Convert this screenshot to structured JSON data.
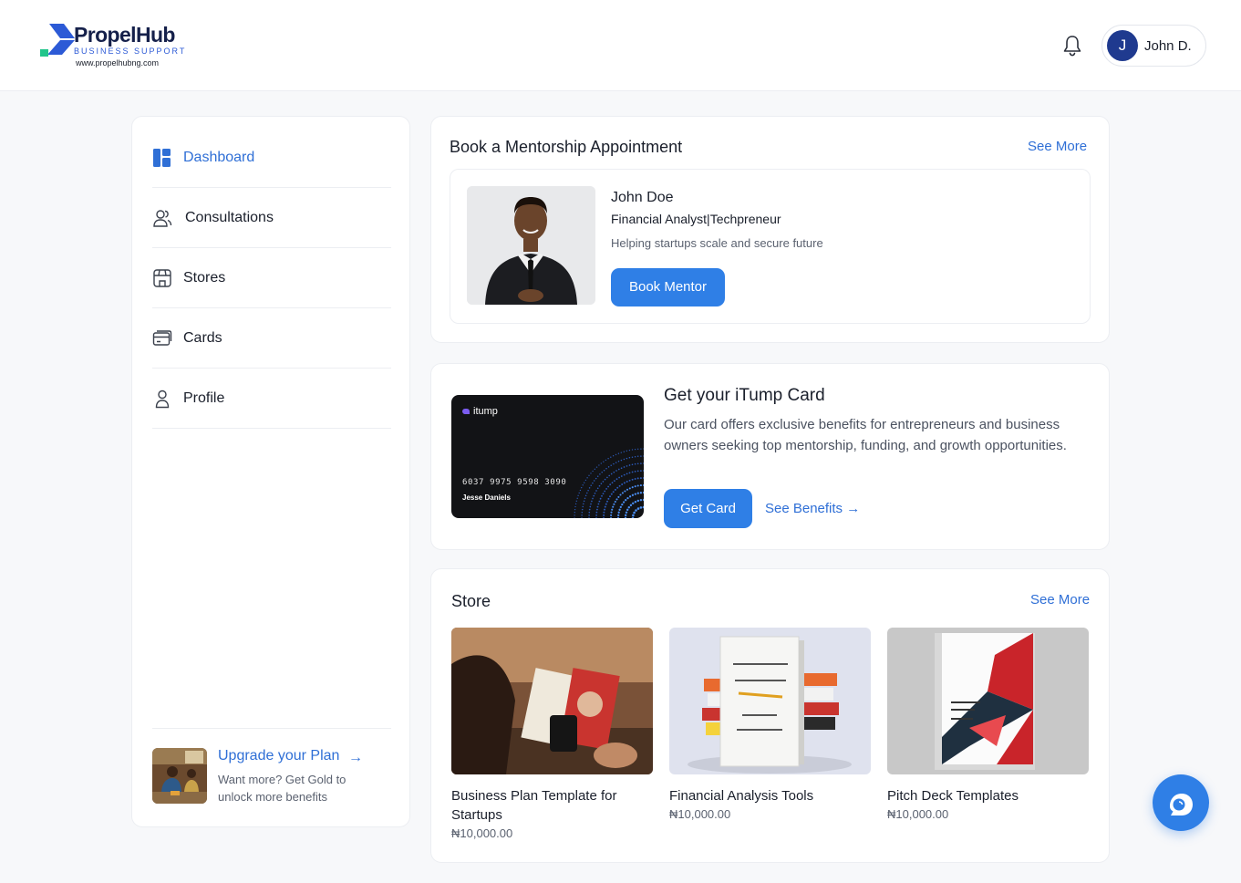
{
  "brand": {
    "name": "PropelHub",
    "subtitle": "BUSINESS SUPPORT",
    "url": "www.propelhubng.com"
  },
  "header": {
    "user_initial": "J",
    "user_name": "John D.",
    "icons": [
      "bell-icon"
    ]
  },
  "sidebar": {
    "items": [
      {
        "label": "Dashboard",
        "icon": "dashboard-icon",
        "active": true
      },
      {
        "label": "Consultations",
        "icon": "users-icon"
      },
      {
        "label": "Stores",
        "icon": "store-icon"
      },
      {
        "label": "Cards",
        "icon": "card-icon"
      },
      {
        "label": "Profile",
        "icon": "user-icon"
      }
    ],
    "upgrade": {
      "title": "Upgrade your Plan",
      "arrow": "→",
      "description": "Want more? Get Gold to unlock more benefits"
    }
  },
  "mentorship": {
    "title": "Book a Mentorship Appointment",
    "see_more": "See More",
    "mentor_name": "John Doe",
    "mentor_role": "Financial Analyst|Techpreneur",
    "mentor_tagline": "Helping startups scale and secure future",
    "book_button": "Book Mentor"
  },
  "itump": {
    "title": "Get your iTump Card",
    "description": "Our card offers exclusive benefits for entrepreneurs and business owners seeking top mentorship, funding, and growth opportunities.",
    "get_button": "Get Card",
    "benefits_link": "See Benefits →",
    "card_brand": "itump",
    "card_number": "6037 9975 9598 3090",
    "card_holder": "Jesse Daniels"
  },
  "store": {
    "title": "Store",
    "see_more": "See More",
    "products": [
      {
        "name": "Business Plan Template for Startups",
        "price": "₦10,000.00"
      },
      {
        "name": "Financial Analysis Tools",
        "price": "₦10,000.00"
      },
      {
        "name": "Pitch Deck Templates",
        "price": "₦10,000.00"
      }
    ]
  },
  "colors": {
    "accent": "#2f7fe6",
    "link": "#2f6fd6",
    "text": "#1a1f2b",
    "muted": "#5b6270",
    "background": "#f7f8fa"
  }
}
